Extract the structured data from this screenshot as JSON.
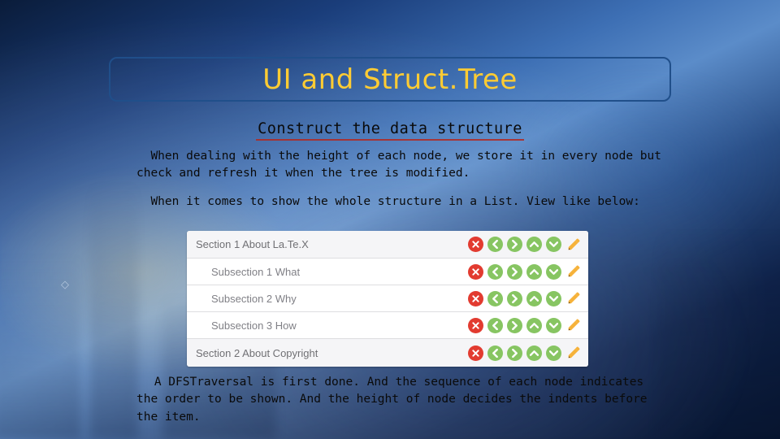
{
  "title": "UI and Struct.Tree",
  "subtitle": "Construct the data structure",
  "paragraphs": {
    "p1": "When dealing with the height of each node, we store it in every node but check and refresh it when the tree is modified.",
    "p2": "When it comes to show the whole structure in a List. View like below:",
    "p3": "A DFSTraversal is first done. And the sequence of each node indicates the order to be shown. And the height of node decides the indents before the item."
  },
  "listview": {
    "rows": [
      {
        "type": "sec",
        "label": "Section 1 About La.Te.X"
      },
      {
        "type": "sub",
        "label": "Subsection 1 What"
      },
      {
        "type": "sub",
        "label": "Subsection 2 Why"
      },
      {
        "type": "sub",
        "label": "Subsection 3 How"
      },
      {
        "type": "sec",
        "label": "Section 2 About Copyright"
      }
    ],
    "icon_names": {
      "delete": "delete-icon",
      "left": "chevron-left-icon",
      "right": "chevron-right-icon",
      "up": "chevron-up-icon",
      "down": "chevron-down-icon",
      "edit": "pencil-icon"
    }
  },
  "sidemark": "◇"
}
